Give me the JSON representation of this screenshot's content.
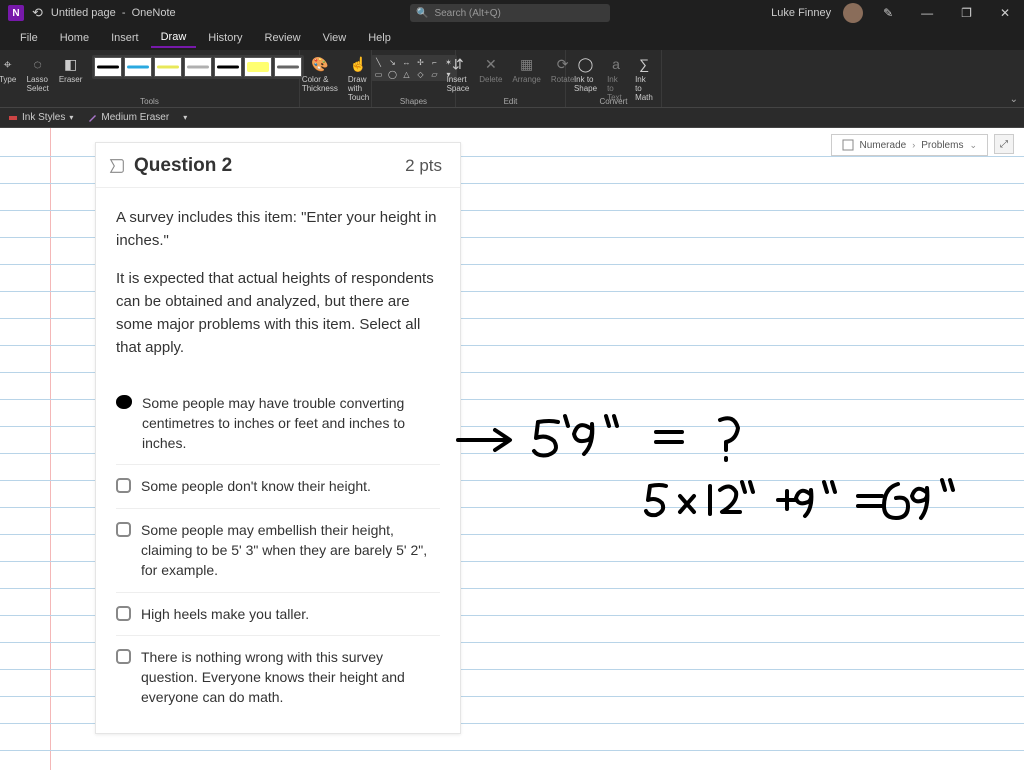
{
  "title_bar": {
    "app_icon_letter": "N",
    "page_title": "Untitled page",
    "app_name": "OneNote",
    "search_placeholder": "Search (Alt+Q)",
    "user_name": "Luke Finney",
    "win_minimize": "—",
    "win_restore": "❐",
    "win_close": "✕"
  },
  "menu": {
    "items": [
      "File",
      "Home",
      "Insert",
      "Draw",
      "History",
      "Review",
      "View",
      "Help"
    ],
    "active_index": 3
  },
  "ribbon": {
    "tools": {
      "type": "Type",
      "lasso": "Lasso Select",
      "eraser": "Eraser"
    },
    "pens": [
      {
        "color": "#000000"
      },
      {
        "color": "#2aa9e0"
      },
      {
        "color": "#e8e85a"
      },
      {
        "color": "#b0b0b0"
      },
      {
        "color": "#000000"
      },
      {
        "color": "#ffff33",
        "highlight": true
      },
      {
        "color": "#666666"
      }
    ],
    "color_thickness": "Color & Thickness",
    "draw_touch": "Draw with Touch",
    "insert_space": "Insert Space",
    "delete": "Delete",
    "arrange": "Arrange",
    "rotate": "Rotate",
    "ink_to_shape": "Ink to Shape",
    "ink_to_text": "Ink to Text",
    "ink_to_math": "Ink to Math",
    "group_tools": "Tools",
    "group_shapes": "Shapes",
    "group_edit": "Edit",
    "group_convert": "Convert"
  },
  "sub_toolbar": {
    "ink_styles": "Ink Styles",
    "medium_eraser": "Medium Eraser"
  },
  "breadcrumb": {
    "section": "Numerade",
    "page_group": "Problems"
  },
  "question": {
    "number": "Question 2",
    "pts": "2 pts",
    "prompt1": "A survey includes this item:  \"Enter your height in inches.\"",
    "prompt2": "It is expected that actual heights of respondents can be obtained and analyzed, but there are some major problems with this item.  Select all that apply.",
    "options": [
      {
        "checked": true,
        "text": "Some people may have trouble converting centimetres to inches or feet and inches to inches."
      },
      {
        "checked": false,
        "text": "Some people don't know their height."
      },
      {
        "checked": false,
        "text": "Some people may embellish their height, claiming to be 5' 3\" when they are barely 5' 2\", for example."
      },
      {
        "checked": false,
        "text": "High heels make you taller."
      },
      {
        "checked": false,
        "text": "There is nothing wrong with this survey question. Everyone knows their height and everyone can do math."
      }
    ]
  },
  "handwriting": {
    "line1": "5'9\"  =  ?",
    "line2": "5 x 12\"  + 9\"   = 69\""
  }
}
